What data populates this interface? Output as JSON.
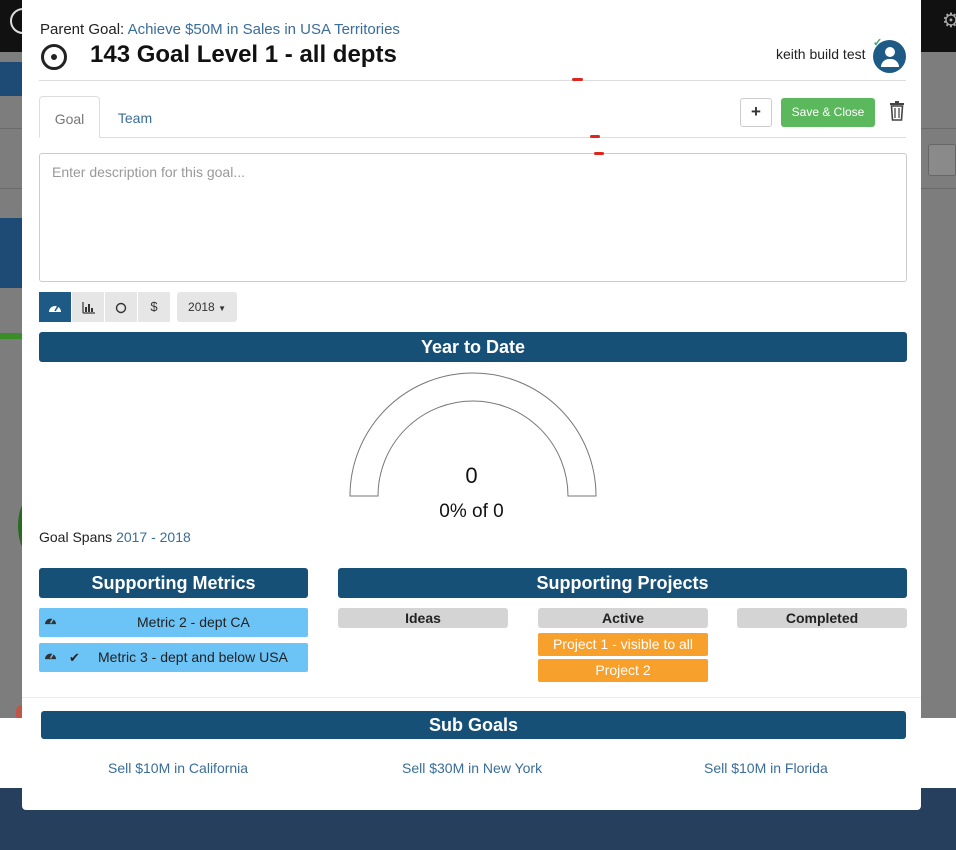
{
  "parent": {
    "label": "Parent Goal:",
    "link": "Achieve $50M in Sales in USA Territories"
  },
  "goal": {
    "title": "143 Goal Level 1 - all depts"
  },
  "owner": {
    "name": "keith build test"
  },
  "tabs": [
    "Goal",
    "Team"
  ],
  "toolbar": {
    "add_label": "+",
    "save_label": "Save & Close"
  },
  "description": {
    "placeholder": "Enter description for this goal..."
  },
  "view_buttons": [
    {
      "icon": "gauge-icon",
      "active": true
    },
    {
      "icon": "bar-chart-icon",
      "active": false
    },
    {
      "icon": "circle-icon",
      "active": false
    },
    {
      "icon": "dollar-icon",
      "glyph": "$",
      "active": false
    }
  ],
  "year_select": "2018",
  "year_to_date": {
    "title": "Year to Date",
    "value": "0",
    "percent_text": "0% of 0"
  },
  "spans": {
    "label": "Goal Spans",
    "range": "2017 - 2018"
  },
  "supporting_metrics": {
    "title": "Supporting Metrics",
    "items": [
      {
        "label": "Metric 2 - dept CA",
        "checked": false
      },
      {
        "label": "Metric 3 - dept and below USA",
        "checked": true
      }
    ]
  },
  "supporting_projects": {
    "title": "Supporting Projects",
    "columns": [
      "Ideas",
      "Active",
      "Completed"
    ],
    "active": [
      "Project 1 - visible to all",
      "Project 2"
    ]
  },
  "sub_goals": {
    "title": "Sub Goals",
    "items": [
      "Sell $10M in California",
      "Sell $30M in New York",
      "Sell $10M in Florida"
    ]
  },
  "colors": {
    "primary": "#175077",
    "success": "#5cb85c",
    "metric": "#6cc3f5",
    "project": "#f7a02b",
    "link": "#3a6d99"
  }
}
